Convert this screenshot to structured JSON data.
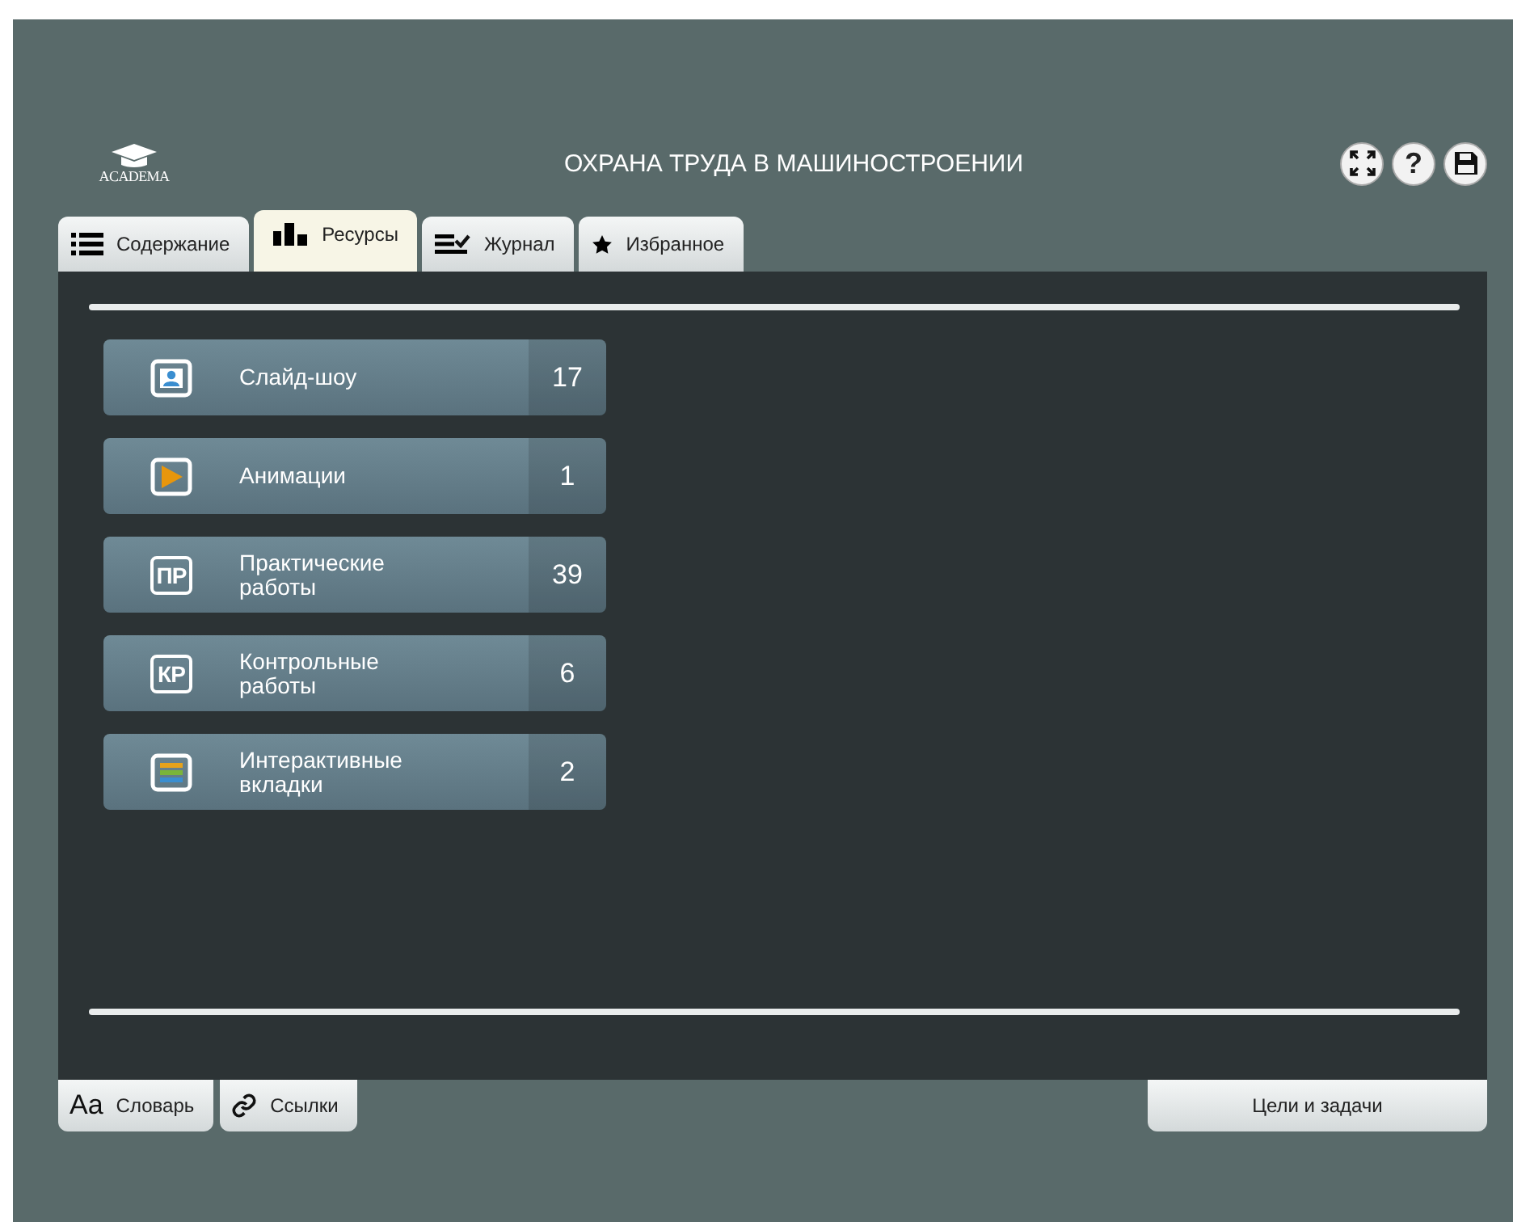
{
  "header": {
    "logo": "ACADEMA",
    "title": "ОХРАНА ТРУДА В МАШИНОСТРОЕНИИ",
    "buttons": [
      {
        "kind": "fullscreen"
      },
      {
        "kind": "help",
        "glyph": "?"
      },
      {
        "kind": "save"
      }
    ]
  },
  "tabs": [
    {
      "label": "Содержание",
      "kind": "list",
      "selected": false
    },
    {
      "label": "Ресурсы",
      "kind": "bars",
      "selected": true
    },
    {
      "label": "Журнал",
      "kind": "checklist",
      "selected": false
    },
    {
      "label": "Избранное",
      "kind": "star",
      "selected": false
    }
  ],
  "resources": [
    {
      "kind": "slideshow",
      "label": "Слайд-шоу",
      "count": "17"
    },
    {
      "kind": "animation",
      "label": "Анимации",
      "count": "1"
    },
    {
      "kind": "badge",
      "badge": "ПР",
      "label": "Практические работы",
      "count": "39"
    },
    {
      "kind": "badge",
      "badge": "КР",
      "label": "Контрольные работы",
      "count": "6"
    },
    {
      "kind": "layers",
      "label": "Интерактивные вкладки",
      "count": "2"
    }
  ],
  "bottom_tabs": [
    {
      "kind": "glossary",
      "glyph": "Aa",
      "label": "Словарь"
    },
    {
      "kind": "links",
      "label": "Ссылки"
    }
  ],
  "goals_button": "Цели и задачи"
}
